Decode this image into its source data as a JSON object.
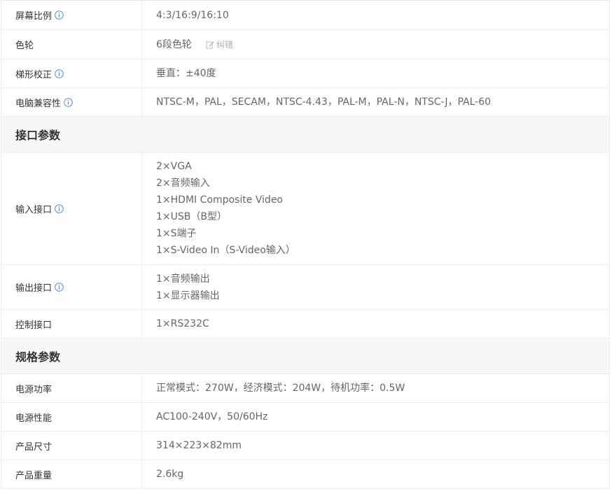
{
  "colors": {
    "info_icon": "#4a90e2",
    "section_bg": "#f7f7f7",
    "border": "#ececec",
    "label_text": "#333333",
    "value_text": "#666666"
  },
  "rows_top": [
    {
      "label": "屏幕比例",
      "info": true,
      "values": [
        "4:3/16:9/16:10"
      ]
    },
    {
      "label": "色轮",
      "info": false,
      "values": [
        "6段色轮"
      ],
      "edit_label": "纠错"
    },
    {
      "label": "梯形校正",
      "info": true,
      "values": [
        "垂直：±40度"
      ]
    },
    {
      "label": "电脑兼容性",
      "info": true,
      "values": [
        "NTSC-M，PAL，SECAM，NTSC-4.43，PAL-M，PAL-N，NTSC-J，PAL-60"
      ]
    }
  ],
  "section_interface": {
    "title": "接口参数"
  },
  "rows_interface": [
    {
      "label": "输入接口",
      "info": true,
      "values": [
        "2×VGA",
        "2×音频输入",
        "1×HDMI Composite Video",
        "1×USB（B型）",
        "1×S端子",
        "1×S-Video In（S-Video输入）"
      ]
    },
    {
      "label": "输出接口",
      "info": true,
      "values": [
        "1×音频输出",
        "1×显示器输出"
      ]
    },
    {
      "label": "控制接口",
      "info": false,
      "values": [
        "1×RS232C"
      ]
    }
  ],
  "section_spec": {
    "title": "规格参数"
  },
  "rows_spec": [
    {
      "label": "电源功率",
      "info": false,
      "values": [
        "正常模式：270W，经济模式：204W，待机功率：0.5W"
      ]
    },
    {
      "label": "电源性能",
      "info": false,
      "values": [
        "AC100-240V，50/60Hz"
      ]
    },
    {
      "label": "产品尺寸",
      "info": false,
      "values": [
        "314×223×82mm"
      ]
    },
    {
      "label": "产品重量",
      "info": false,
      "values": [
        "2.6kg"
      ]
    }
  ]
}
